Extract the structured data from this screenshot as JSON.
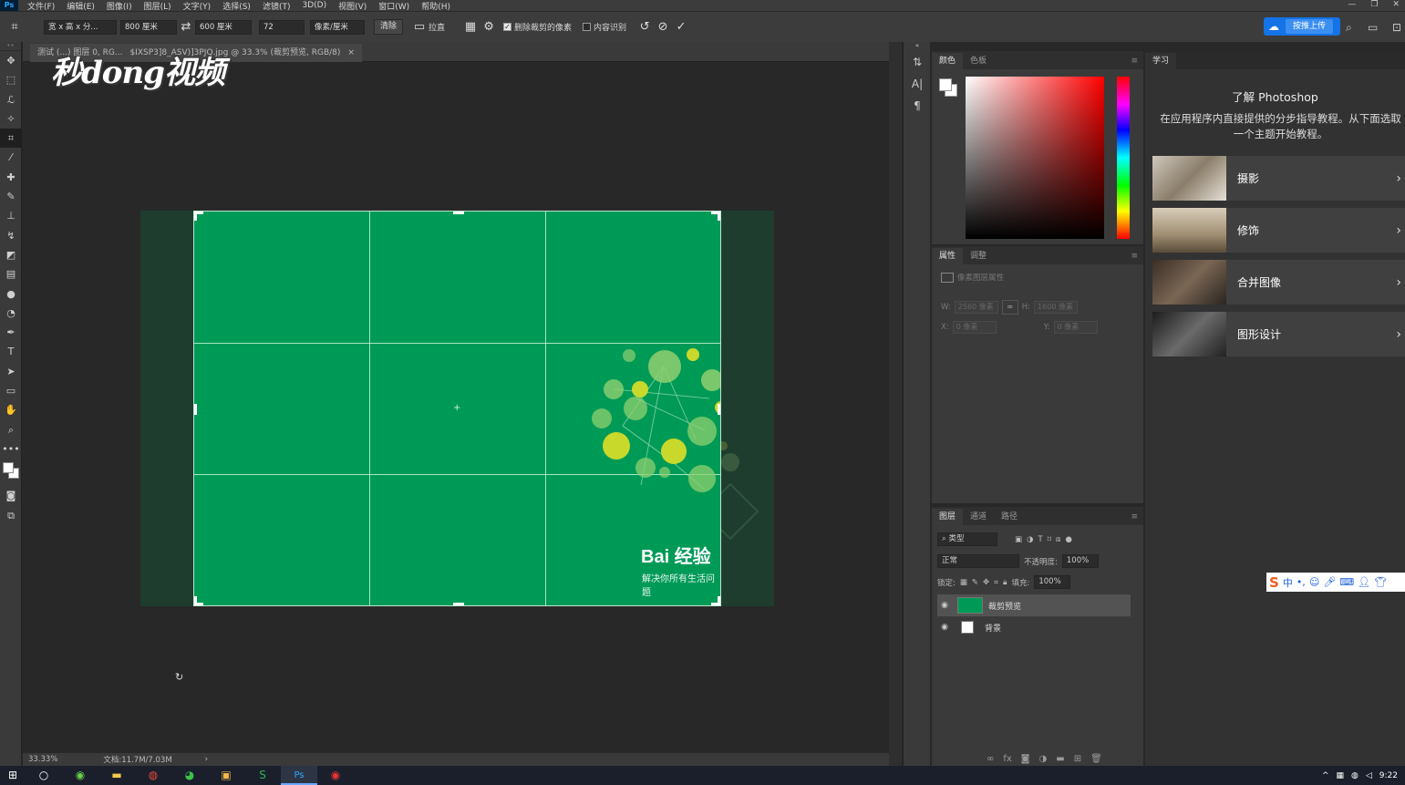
{
  "app": {
    "logo": "Ps",
    "menu": [
      "文件(F)",
      "编辑(E)",
      "图像(I)",
      "图层(L)",
      "文字(Y)",
      "选择(S)",
      "滤镜(T)",
      "3D(D)",
      "视图(V)",
      "窗口(W)",
      "帮助(H)"
    ],
    "window_buttons": [
      "—",
      "❐",
      "✕"
    ]
  },
  "options": {
    "ratio_select": "宽 x 高 x 分...",
    "width": "800 厘米",
    "height": "600 厘米",
    "resolution": "72",
    "unit_select": "像素/厘米",
    "clear_btn": "清除",
    "straighten": "拉直",
    "delete_cropped": "删除裁剪的像素",
    "content_aware": "内容识别",
    "share_label": "按推上传"
  },
  "document": {
    "tab_prefix": "测试 (...) 图层 0, RG...",
    "tab_title": "$IXSP3]8_ASV)]3PJQ.jpg @ 33.3% (裁剪预览, RGB/8)",
    "tab_close": "×",
    "watermark": "秒dong视频",
    "brand": "Bai 经验",
    "brand_slogan": "解决你所有生活问题"
  },
  "status": {
    "zoom": "33.33%",
    "doc_size": "文档:11.7M/7.03M",
    "arrow": "›"
  },
  "color_panel": {
    "tabs": [
      "颜色",
      "色板"
    ],
    "menu": "≡"
  },
  "properties_panel": {
    "tabs": [
      "属性",
      "调整"
    ],
    "menu": "≡",
    "title": "像素图层属性",
    "w_label": "W:",
    "w_value": "2560 像素",
    "h_label": "H:",
    "h_value": "1600 像素",
    "x_label": "X:",
    "x_value": "0 像素",
    "y_label": "Y:",
    "y_value": "0 像素"
  },
  "layers_panel": {
    "tabs": [
      "图层",
      "通道",
      "路径"
    ],
    "menu": "≡",
    "search_placeholder": "类型",
    "blend_mode": "正常",
    "opacity_label": "不透明度:",
    "opacity_value": "100%",
    "lock_label": "锁定:",
    "fill_label": "填充:",
    "fill_value": "100%",
    "layers": [
      {
        "name": "裁剪预览",
        "selected": true,
        "thumb_color": "#009a57"
      },
      {
        "name": "背景",
        "selected": false,
        "thumb_color": "#ffffff"
      }
    ]
  },
  "learn_panel": {
    "tab": "学习",
    "title": "了解 Photoshop",
    "description": "在应用程序内直接提供的分步指导教程。从下面选取一个主题开始教程。",
    "items": [
      {
        "label": "摄影"
      },
      {
        "label": "修饰"
      },
      {
        "label": "合并图像"
      },
      {
        "label": "图形设计"
      }
    ]
  },
  "ime": {
    "logo": "S",
    "mode": "中"
  },
  "taskbar": {
    "time": "9:22"
  },
  "colors": {
    "canvas_green": "#009a57",
    "doc_dark": "#1e3d2f",
    "accent_blue": "#1473e6",
    "bubble_yellow": "#c8d92b"
  }
}
